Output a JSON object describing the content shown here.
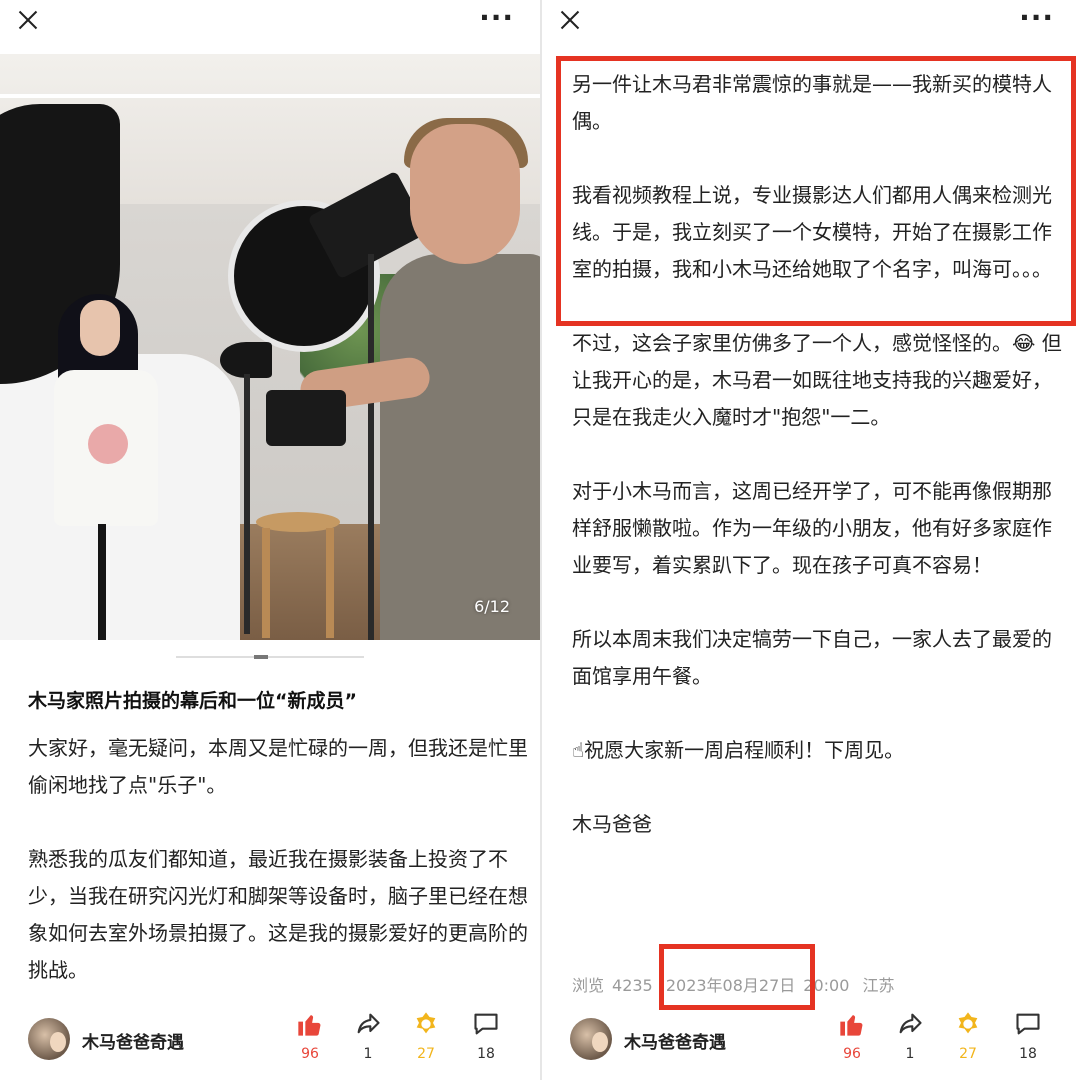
{
  "left": {
    "page_indicator": "6/12",
    "article_title": "木马家照片拍摄的幕后和一位“新成员”",
    "paragraphs": [
      "大家好，毫无疑问，本周又是忙碌的一周，但我还是忙里偷闲地找了点\"乐子\"。",
      "熟悉我的瓜友们都知道，最近我在摄影装备上投资了不少，当我在研究闪光灯和脚架等设备时，脑子里已经在想象如何去室外场景拍摄了。这是我的摄影爱好的更高阶的挑战。"
    ]
  },
  "right": {
    "paragraphs": [
      "另一件让木马君非常震惊的事就是——我新买的模特人偶。",
      "我看视频教程上说，专业摄影达人们都用人偶来检测光线。于是，我立刻买了一个女模特，开始了在摄影工作室的拍摄，我和小木马还给她取了个名字，叫海可。。。",
      "不过，这会子家里仿佛多了一个人，感觉怪怪的。😂 但让我开心的是，木马君一如既往地支持我的兴趣爱好，只是在我走火入魔时才\"抱怨\"一二。",
      "对于小木马而言，这周已经开学了，可不能再像假期那样舒服懒散啦。作为一年级的小朋友，他有好多家庭作业要写，着实累趴下了。现在孩子可真不容易！",
      "所以本周末我们决定犒劳一下自己，一家人去了最爱的面馆享用午餐。",
      "☝祝愿大家新一周启程顺利！下周见。",
      "木马爸爸"
    ],
    "meta": {
      "views_label": "浏览",
      "views": "4235",
      "date": "2023年08月27日",
      "time": "20:00",
      "location": "江苏"
    }
  },
  "footer": {
    "author": "木马爸爸奇遇",
    "likes": "96",
    "shares": "1",
    "coins": "27",
    "comments": "18"
  },
  "colors": {
    "like": "#e8463a",
    "coin": "#f2b51c",
    "highlight": "#e53322"
  },
  "icons": [
    "close-icon",
    "more-icon",
    "thumb-up-icon",
    "share-icon",
    "coin-icon",
    "comment-icon"
  ]
}
